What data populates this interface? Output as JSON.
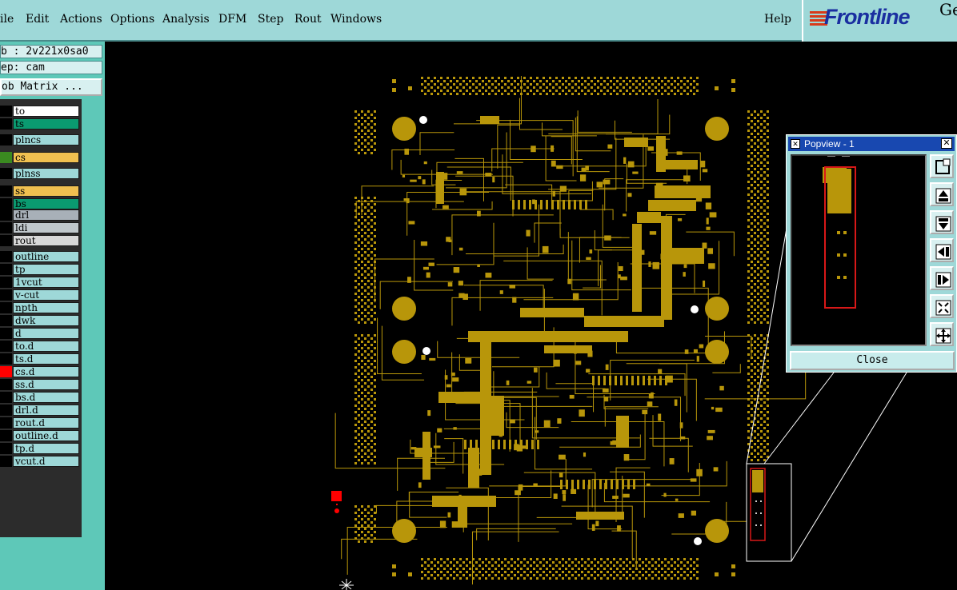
{
  "menu": {
    "items": [
      "ile",
      "Edit",
      "Actions",
      "Options",
      "Analysis",
      "DFM",
      "Step",
      "Rout",
      "Windows"
    ],
    "help": "Help"
  },
  "logo": {
    "brand": "Frontline",
    "suffix": "Ge"
  },
  "job": {
    "job_label": "b : 2v221x0sa0",
    "step_label": "ep: cam",
    "matrix_button": "ob Matrix ..."
  },
  "layers": [
    {
      "name": "to",
      "swatch": "#000000",
      "bg": "#ffffff"
    },
    {
      "name": "ts",
      "swatch": "#000000",
      "bg": "#0a9a70"
    },
    {
      "name": "plncs",
      "swatch": "#000000",
      "bg": "#9ed8d8"
    },
    {
      "name": "cs",
      "swatch": "#3a8a20",
      "bg": "#f0c050"
    },
    {
      "name": "plnss",
      "swatch": "#000000",
      "bg": "#9ed8d8"
    },
    {
      "name": "ss",
      "swatch": "#000000",
      "bg": "#f0c050"
    },
    {
      "name": "bs",
      "swatch": "#000000",
      "bg": "#0a9a70"
    },
    {
      "name": "drl",
      "swatch": "#000000",
      "bg": "#a8b0b8"
    },
    {
      "name": "ldi",
      "swatch": "#000000",
      "bg": "#c0c8cc"
    },
    {
      "name": "rout",
      "swatch": "#000000",
      "bg": "#d8d8d8"
    },
    {
      "name": "outline",
      "swatch": "#000000",
      "bg": "#9ed8d8"
    },
    {
      "name": "tp",
      "swatch": "#000000",
      "bg": "#9ed8d8"
    },
    {
      "name": "1vcut",
      "swatch": "#000000",
      "bg": "#9ed8d8"
    },
    {
      "name": "v-cut",
      "swatch": "#000000",
      "bg": "#9ed8d8"
    },
    {
      "name": "npth",
      "swatch": "#000000",
      "bg": "#9ed8d8"
    },
    {
      "name": "dwk",
      "swatch": "#000000",
      "bg": "#9ed8d8"
    },
    {
      "name": "d",
      "swatch": "#000000",
      "bg": "#9ed8d8"
    },
    {
      "name": "to.d",
      "swatch": "#000000",
      "bg": "#9ed8d8"
    },
    {
      "name": "ts.d",
      "swatch": "#000000",
      "bg": "#9ed8d8"
    },
    {
      "name": "cs.d",
      "swatch": "#ff0000",
      "bg": "#9ed8d8",
      "mark": "⊞"
    },
    {
      "name": "ss.d",
      "swatch": "#000000",
      "bg": "#9ed8d8"
    },
    {
      "name": "bs.d",
      "swatch": "#000000",
      "bg": "#9ed8d8"
    },
    {
      "name": "drl.d",
      "swatch": "#000000",
      "bg": "#9ed8d8"
    },
    {
      "name": "rout.d",
      "swatch": "#000000",
      "bg": "#9ed8d8"
    },
    {
      "name": "outline.d",
      "swatch": "#000000",
      "bg": "#9ed8d8"
    },
    {
      "name": "tp.d",
      "swatch": "#000000",
      "bg": "#9ed8d8"
    },
    {
      "name": "vcut.d",
      "swatch": "#000000",
      "bg": "#9ed8d8"
    }
  ],
  "popview": {
    "title": "Popview - 1",
    "close_label": "Close",
    "buttons": [
      "zoom-fit-icon",
      "pan-up-icon",
      "pan-down-icon",
      "pan-left-icon",
      "pan-right-icon",
      "zoom-in-icon",
      "zoom-out-icon"
    ]
  },
  "colors": {
    "copper": "#b8960a",
    "panel": "#9ed8d8",
    "selection": "#ff0000"
  }
}
